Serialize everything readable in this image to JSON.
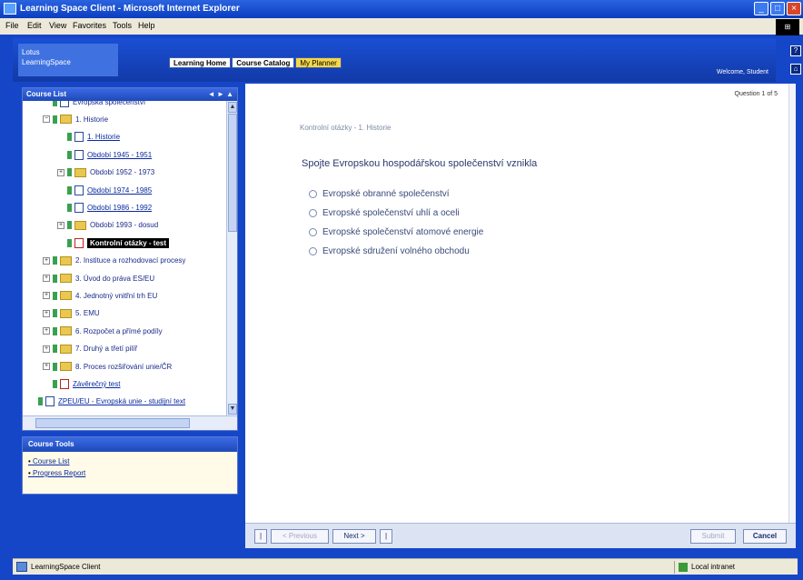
{
  "window": {
    "title": "Learning Space Client - Microsoft Internet Explorer",
    "controls": [
      "_",
      "□",
      "×"
    ]
  },
  "menu": [
    "File",
    "Edit",
    "View",
    "Favorites",
    "Tools",
    "Help"
  ],
  "header": {
    "logo_line1": "Lotus",
    "logo_line2": "LearningSpace",
    "tabs": [
      "Learning Home",
      "Course Catalog",
      "My Planner"
    ],
    "active_tab": 2,
    "welcome": "Welcome, Student"
  },
  "side_icons": [
    "?",
    "⌂"
  ],
  "course_list": {
    "title": "Course List",
    "controls": "◄ ► ▲",
    "items": [
      {
        "label": "Evropská společenství",
        "type": "page",
        "indent": 1,
        "link": false
      },
      {
        "label": "1. Historie",
        "type": "folder",
        "indent": 1,
        "expander": "−"
      },
      {
        "label": "1. Historie",
        "type": "page",
        "indent": 2,
        "link": true
      },
      {
        "label": "Období 1945 - 1951",
        "type": "page",
        "indent": 2,
        "link": true
      },
      {
        "label": "Období 1952 - 1973",
        "type": "folder",
        "indent": 2,
        "expander": "+"
      },
      {
        "label": "Období 1974 - 1985",
        "type": "page",
        "indent": 2,
        "link": true
      },
      {
        "label": "Období 1986 - 1992",
        "type": "page",
        "indent": 2,
        "link": true
      },
      {
        "label": "Období 1993 - dosud",
        "type": "folder",
        "indent": 2,
        "expander": "+"
      },
      {
        "label": "Kontrolní otázky - test",
        "type": "test",
        "indent": 2,
        "selected": true
      },
      {
        "label": "2. Instituce a rozhodovací procesy",
        "type": "folder",
        "indent": 1,
        "expander": "+"
      },
      {
        "label": "3. Úvod do práva ES/EU",
        "type": "folder",
        "indent": 1,
        "expander": "+"
      },
      {
        "label": "4. Jednotný vnitřní trh EU",
        "type": "folder",
        "indent": 1,
        "expander": "+"
      },
      {
        "label": "5. EMU",
        "type": "folder",
        "indent": 1,
        "expander": "+"
      },
      {
        "label": "6. Rozpočet a přímé podíly",
        "type": "folder",
        "indent": 1,
        "expander": "+"
      },
      {
        "label": "7. Druhý a třetí pilíř",
        "type": "folder",
        "indent": 1,
        "expander": "+"
      },
      {
        "label": "8. Proces rozšiřování unie/ČR",
        "type": "folder",
        "indent": 1,
        "expander": "+"
      },
      {
        "label": "Závěrečný test",
        "type": "test",
        "indent": 1,
        "link": true
      },
      {
        "label": "ZPEU/EU - Evropská unie - studijní text",
        "type": "course",
        "indent": 0,
        "link": true
      }
    ]
  },
  "course_tools": {
    "title": "Course Tools",
    "items": [
      "Course List",
      "Progress Report"
    ]
  },
  "question": {
    "number": "Question 1 of 5",
    "heading": "Kontrolní otázky - 1. Historie",
    "text": "Spojte Evropskou hospodářskou společenství vznikla",
    "options": [
      "Evropské obranné společenství",
      "Evropské společenství uhlí a oceli",
      "Evropské společenství atomové energie",
      "Evropské sdružení volného obchodu"
    ]
  },
  "bottom": {
    "prev": "< Previous",
    "next": "Next >",
    "submit": "Submit",
    "cancel": "Cancel"
  },
  "status": {
    "text": "LearningSpace Client",
    "zone": "Local intranet"
  }
}
